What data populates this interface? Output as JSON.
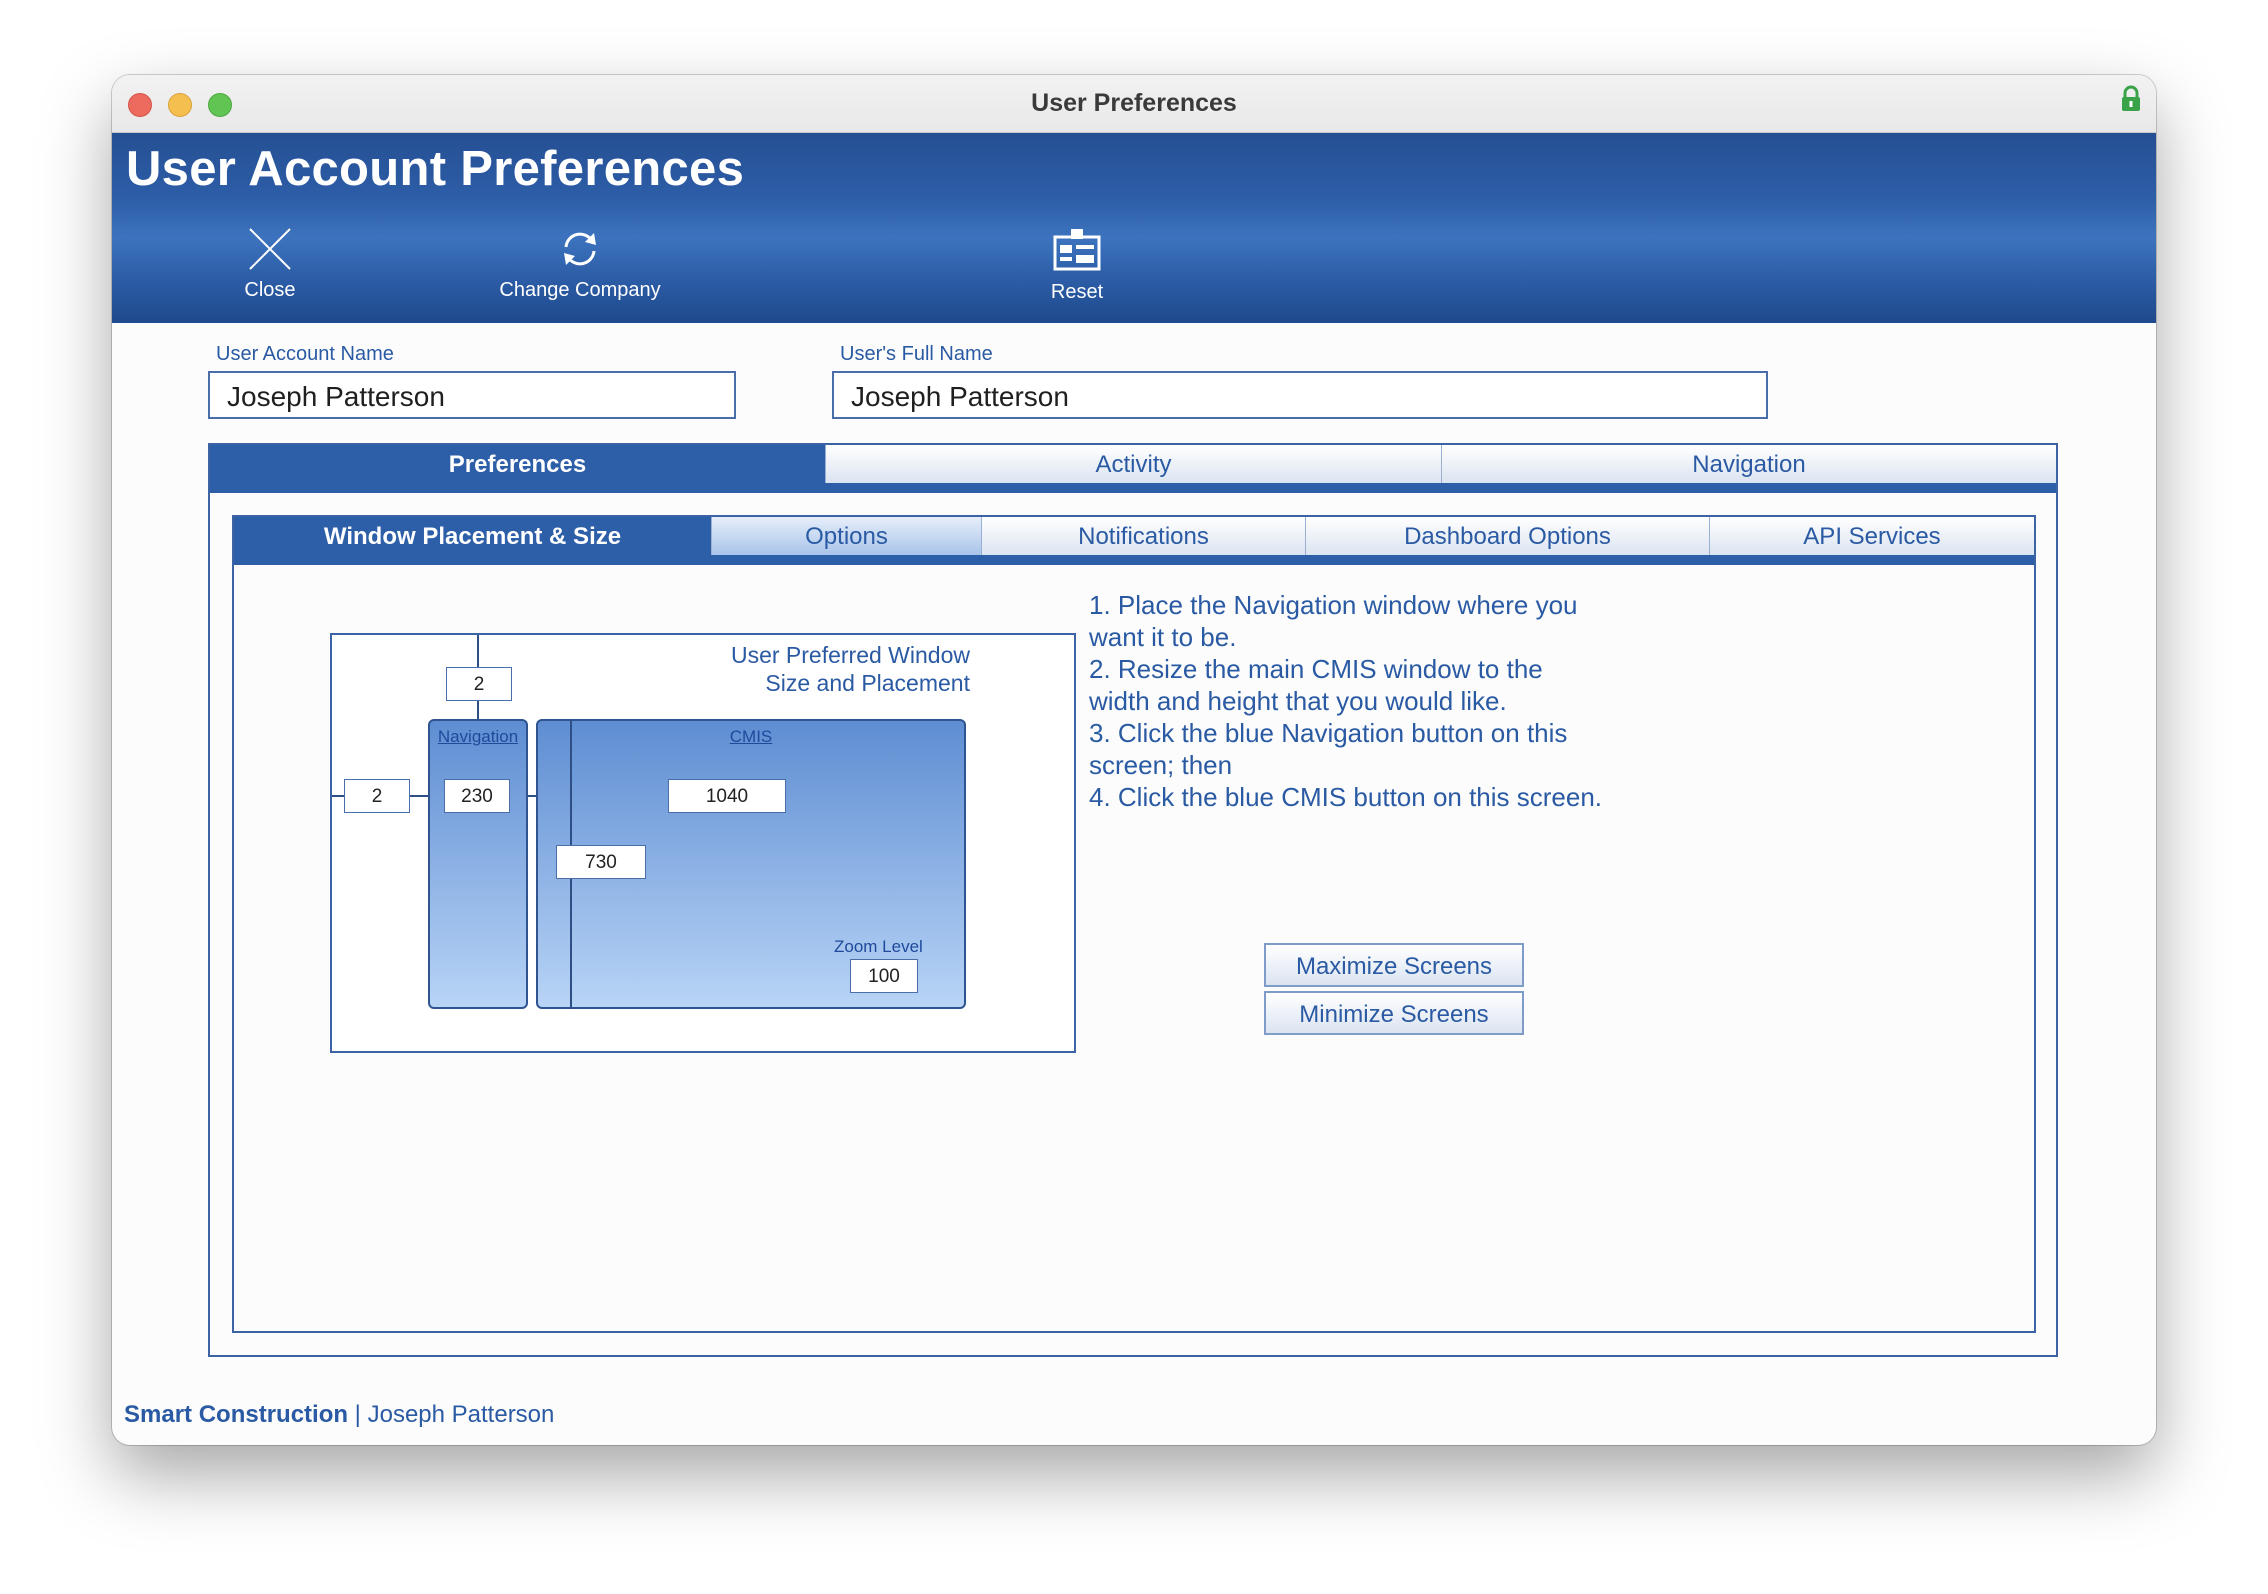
{
  "window": {
    "title": "User Preferences"
  },
  "header": {
    "title": "User Account Preferences",
    "tools": {
      "close": "Close",
      "change_company": "Change Company",
      "reset": "Reset"
    }
  },
  "fields": {
    "account_name": {
      "label": "User Account Name",
      "value": "Joseph Patterson"
    },
    "full_name": {
      "label": "User's Full Name",
      "value": "Joseph Patterson"
    }
  },
  "main_tabs": [
    "Preferences",
    "Activity",
    "Navigation"
  ],
  "sub_tabs": [
    "Window Placement & Size",
    "Options",
    "Notifications",
    "Dashboard Options",
    "API Services"
  ],
  "diagram": {
    "title_line1": "User Preferred Window",
    "title_line2": "Size and Placement",
    "nav_label": "Navigation",
    "cmis_label": "CMIS",
    "top_offset": "2",
    "left_offset": "2",
    "nav_width": "230",
    "cmis_width": "1040",
    "cmis_height": "730",
    "zoom_label": "Zoom Level",
    "zoom_value": "100"
  },
  "instructions": [
    "1. Place the Navigation window where you want it to be.",
    "2. Resize the main CMIS window to the width and height that you would like.",
    "3. Click the blue Navigation button on this screen; then",
    "4. Click the blue CMIS button on this screen."
  ],
  "buttons": {
    "maximize": "Maximize Screens",
    "minimize": "Minimize Screens"
  },
  "footer": {
    "company": "Smart Construction",
    "separator": " | ",
    "user": "Joseph Patterson"
  },
  "colors": {
    "accent": "#2d5ea8",
    "text_blue": "#2a5aa3",
    "header_light": "#3d73be"
  }
}
